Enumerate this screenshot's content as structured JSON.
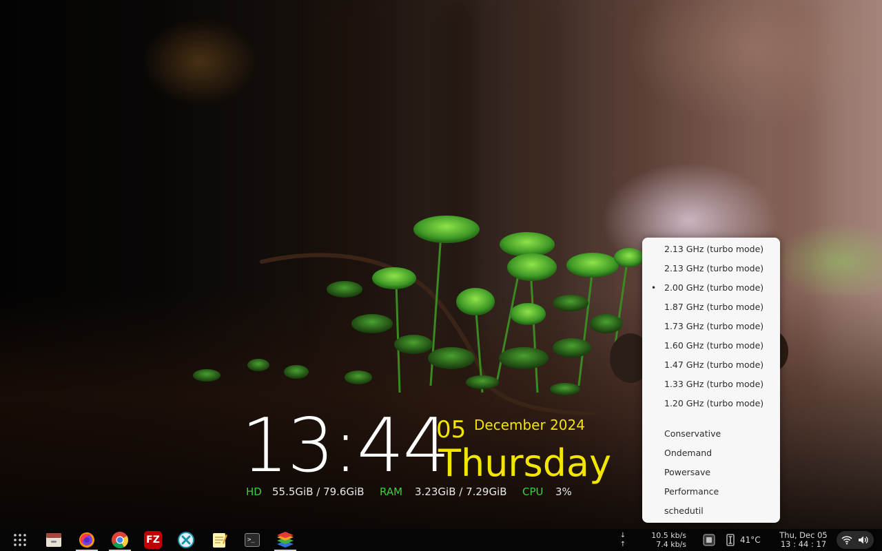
{
  "desktop": {
    "clock": {
      "time": "13:44",
      "day_number": "05",
      "month_year": "December 2024",
      "weekday": "Thursday"
    },
    "stats": {
      "hd_label": "HD",
      "hd_value": "55.5GiB / 79.6GiB",
      "ram_label": "RAM",
      "ram_value": "3.23GiB / 7.29GiB",
      "cpu_label": "CPU",
      "cpu_value": "3%"
    },
    "colors": {
      "clock_time": "#ffffff",
      "clock_date": "#f2e600",
      "stat_label": "#3ecf3e"
    }
  },
  "cpu_frequency_menu": {
    "frequencies": [
      {
        "label": "2.13 GHz (turbo mode)",
        "selected": false
      },
      {
        "label": "2.13 GHz (turbo mode)",
        "selected": false
      },
      {
        "label": "2.00 GHz (turbo mode)",
        "selected": true
      },
      {
        "label": "1.87 GHz (turbo mode)",
        "selected": false
      },
      {
        "label": "1.73 GHz (turbo mode)",
        "selected": false
      },
      {
        "label": "1.60 GHz (turbo mode)",
        "selected": false
      },
      {
        "label": "1.47 GHz (turbo mode)",
        "selected": false
      },
      {
        "label": "1.33 GHz (turbo mode)",
        "selected": false
      },
      {
        "label": "1.20 GHz (turbo mode)",
        "selected": false
      }
    ],
    "governors": [
      "Conservative",
      "Ondemand",
      "Powersave",
      "Performance",
      "schedutil"
    ],
    "selected_marker": "•"
  },
  "taskbar": {
    "apps": [
      {
        "name": "app-grid",
        "icon": "grid-icon"
      },
      {
        "name": "files",
        "icon": "file-manager-icon"
      },
      {
        "name": "firefox",
        "icon": "firefox-icon",
        "active": true
      },
      {
        "name": "chrome",
        "icon": "chrome-icon",
        "active": true
      },
      {
        "name": "filezilla",
        "icon": "filezilla-icon",
        "glyph": "FZ"
      },
      {
        "name": "teamviewer-like",
        "icon": "remote-desktop-icon"
      },
      {
        "name": "text-editor",
        "icon": "text-editor-icon"
      },
      {
        "name": "terminal",
        "icon": "terminal-icon",
        "glyph": ">_"
      },
      {
        "name": "layers-app",
        "icon": "layers-icon",
        "active": true
      }
    ],
    "tray": {
      "net_down_arrow": "↓",
      "net_up_arrow": "↑",
      "net_down": "10.5 kb/s",
      "net_up": "7.4 kb/s",
      "temperature": "41°C",
      "date": "Thu, Dec 05",
      "time": "13 : 44 : 17"
    }
  }
}
